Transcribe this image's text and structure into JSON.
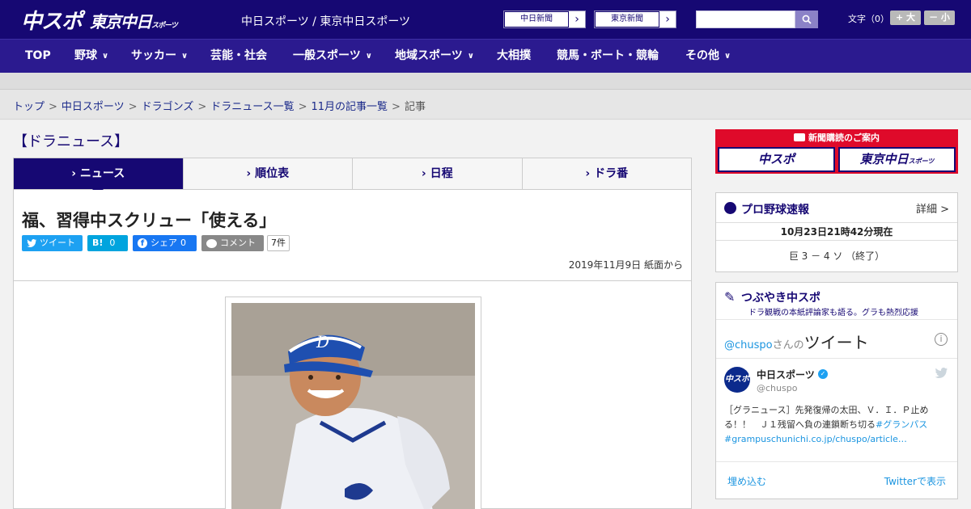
{
  "header": {
    "logo_primary": "中スポ",
    "logo_secondary": "東京中日",
    "logo_secondary_small": "スポーツ",
    "site_title": "中日スポーツ / 東京中日スポーツ",
    "paper_links": [
      {
        "label": "中日新聞"
      },
      {
        "label": "東京新聞"
      }
    ],
    "search": {
      "value": "",
      "placeholder": ""
    },
    "font_size": {
      "label": "文字（0）",
      "larger": "+ 大",
      "smaller": "－ 小"
    }
  },
  "nav": {
    "items": [
      {
        "label": "TOP",
        "has_dropdown": false
      },
      {
        "label": "野球",
        "has_dropdown": true
      },
      {
        "label": "サッカー",
        "has_dropdown": true
      },
      {
        "label": "芸能・社会",
        "has_dropdown": false
      },
      {
        "label": "一般スポーツ",
        "has_dropdown": true
      },
      {
        "label": "地域スポーツ",
        "has_dropdown": true
      },
      {
        "label": "大相撲",
        "has_dropdown": false
      },
      {
        "label": "競馬・ボート・競輪",
        "has_dropdown": false
      },
      {
        "label": "その他",
        "has_dropdown": true
      }
    ]
  },
  "breadcrumb": {
    "items": [
      "トップ",
      "中日スポーツ",
      "ドラゴンズ",
      "ドラニュース一覧",
      "11月の記事一覧",
      "記事"
    ]
  },
  "section": {
    "title": "【ドラニュース】",
    "tabs": [
      {
        "label": "ニュース",
        "active": true
      },
      {
        "label": "順位表",
        "active": false
      },
      {
        "label": "日程",
        "active": false
      },
      {
        "label": "ドラ番",
        "active": false
      }
    ]
  },
  "article": {
    "headline": "福、習得中スクリュー「使える」",
    "share": {
      "tweet": "ツイート",
      "hatena_icon": "B!",
      "hatena_count": "0",
      "facebook": "シェア",
      "facebook_count": "0",
      "comment": "コメント",
      "comment_count": "7件"
    },
    "date": "2019年11月9日 紙面から"
  },
  "sidebar": {
    "subscribe": {
      "title": "新聞購読のご案内",
      "logo1": "中スポ",
      "logo2": "東京中日",
      "logo2_small": "スポーツ"
    },
    "baseball": {
      "title": "プロ野球速報",
      "more": "詳細 >",
      "timestamp": "10月23日21時42分現在",
      "score": "巨 3 － 4 ソ （終了）"
    },
    "tweets": {
      "title": "つぶやき中スポ",
      "subtitle": "ドラ観戦の本紙評論家も語る。グラも熱烈応援",
      "embed_header_handle": "@chuspo",
      "embed_header_suffix": "さんの",
      "embed_header_title": "ツイート",
      "user_name": "中日スポーツ",
      "user_handle": "@chuspo",
      "avatar_text": "中スポ",
      "body": "［グラニュース］先発復帰の太田、Ｖ．Ｉ．Ｐ止める！！　Ｊ１残留へ負の連鎖断ち切る",
      "body_hashtag": "#グランパス",
      "body_link": "#grampuschunichi.co.jp/chuspo/article…",
      "embed_link": "埋め込む",
      "view_link": "Twitterで表示"
    }
  },
  "colors": {
    "brand_navy": "#160873",
    "nav_bg": "#2b1a8f",
    "subscribe_red": "#df0a2a",
    "twitter_blue": "#1da1f2"
  }
}
